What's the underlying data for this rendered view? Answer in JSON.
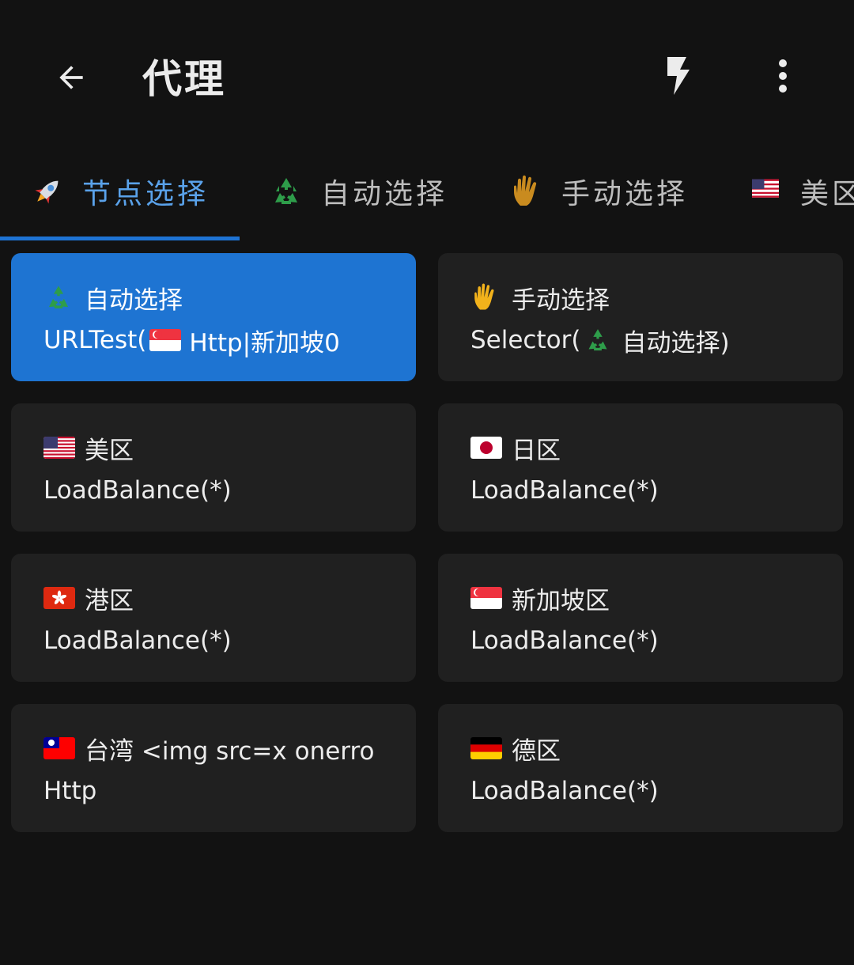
{
  "appbar": {
    "title": "代理",
    "icons": [
      "back-arrow-icon",
      "flash-icon",
      "more-vert-icon"
    ]
  },
  "tabs": [
    {
      "label": "节点选择",
      "icon": "rocket-icon",
      "active": true
    },
    {
      "label": "自动选择",
      "icon": "recycle-icon",
      "active": false
    },
    {
      "label": "手动选择",
      "icon": "raised-hand-icon",
      "active": false
    },
    {
      "label": "美区",
      "icon": "flag-us-icon",
      "active": false
    }
  ],
  "proxies": [
    {
      "name": "自动选择",
      "icon": "recycle-icon",
      "type_prefix": "URLTest(",
      "type_icon": "flag-sg-icon",
      "type_suffix": "Http|新加坡0",
      "selected": true
    },
    {
      "name": "手动选择",
      "icon": "raised-hand-icon",
      "type_prefix": "Selector(",
      "type_icon": "recycle-icon",
      "type_suffix": "自动选择)",
      "selected": false
    },
    {
      "name": "美区",
      "icon": "flag-us-icon",
      "type": "LoadBalance(*)",
      "selected": false
    },
    {
      "name": "日区",
      "icon": "flag-jp-icon",
      "type": "LoadBalance(*)",
      "selected": false
    },
    {
      "name": "港区",
      "icon": "flag-hk-icon",
      "type": "LoadBalance(*)",
      "selected": false
    },
    {
      "name": "新加坡区",
      "icon": "flag-sg-icon",
      "type": "LoadBalance(*)",
      "selected": false
    },
    {
      "name": "台湾 <img src=x onerro",
      "icon": "flag-tw-icon",
      "type": "Http",
      "selected": false
    },
    {
      "name": "德区",
      "icon": "flag-de-icon",
      "type": "LoadBalance(*)",
      "selected": false
    }
  ],
  "colors": {
    "background": "#121212",
    "card": "#202020",
    "selected_card": "#1e74d2",
    "active_tab": "#5aa2ea",
    "indicator": "#1e73d4"
  }
}
